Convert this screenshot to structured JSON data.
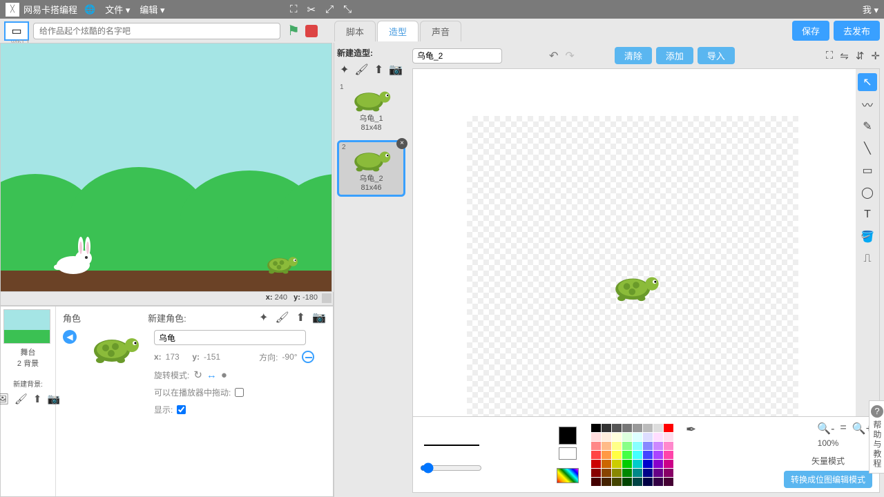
{
  "topbar": {
    "brand": "网易卡搭编程",
    "globe": "🌐",
    "file_menu": "文件 ▾",
    "edit_menu": "编辑 ▾",
    "me": "我 ▾"
  },
  "row2": {
    "version": "v461.1",
    "title_placeholder": "给作品起个炫酷的名字吧",
    "tabs": {
      "scripts": "脚本",
      "costumes": "造型",
      "sounds": "声音"
    },
    "save": "保存",
    "publish": "去发布"
  },
  "stage": {
    "coord_lx": "x:",
    "coord_x": "240",
    "coord_ly": "y:",
    "coord_y": "-180"
  },
  "sprite_panel": {
    "left": {
      "stage_label": "舞台",
      "bg_count": "2 背景",
      "new_bg": "新建背景:"
    },
    "header": "角色",
    "new_sprite": "新建角色:",
    "sprite_name": "乌龟",
    "pos_lx": "x:",
    "pos_x": "173",
    "pos_ly": "y:",
    "pos_y": "-151",
    "dir_label": "方向:",
    "dir_val": "-90°",
    "rotate_label": "旋转模式:",
    "drag_label": "可以在播放器中拖动:",
    "show_label": "显示:"
  },
  "costumes_col": {
    "title": "新建造型:",
    "items": [
      {
        "num": "1",
        "name": "乌龟_1",
        "size": "81x48"
      },
      {
        "num": "2",
        "name": "乌龟_2",
        "size": "81x46"
      }
    ]
  },
  "editor": {
    "name_input": "乌龟_2",
    "actions": {
      "clear": "清除",
      "add": "添加",
      "import": "导入"
    },
    "zoom_pct": "100%",
    "mode_label": "矢量模式",
    "convert_btn": "转换成位图编辑模式"
  },
  "help": {
    "title": "帮助与教程"
  },
  "palette_colors": [
    "#000",
    "#333",
    "#555",
    "#777",
    "#999",
    "#bbb",
    "#ddd",
    "#f00",
    "#fdd",
    "#fed",
    "#ffd",
    "#dfd",
    "#dff",
    "#ddf",
    "#fdf",
    "#fde",
    "#f88",
    "#fb8",
    "#ff8",
    "#8f8",
    "#8ff",
    "#88f",
    "#c8f",
    "#f8c",
    "#f44",
    "#f94",
    "#ff4",
    "#4f4",
    "#4ff",
    "#44f",
    "#a4f",
    "#f4a",
    "#c00",
    "#c60",
    "#cc0",
    "#0c0",
    "#0cc",
    "#00c",
    "#80c",
    "#c08",
    "#800",
    "#840",
    "#880",
    "#080",
    "#088",
    "#008",
    "#608",
    "#806",
    "#400",
    "#420",
    "#440",
    "#040",
    "#044",
    "#004",
    "#304",
    "#403"
  ]
}
